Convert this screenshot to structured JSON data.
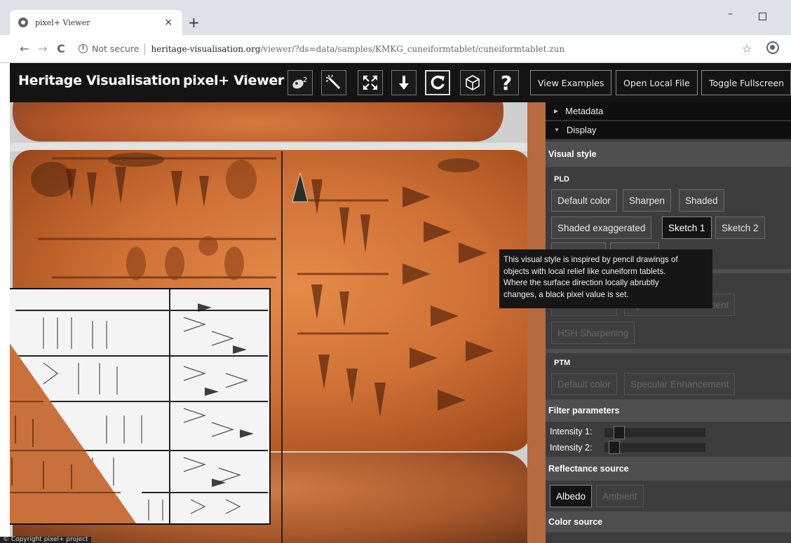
{
  "browser": {
    "tab_title": "pixel+ Viewer",
    "tab_close": "×",
    "new_tab": "+",
    "minimize": "–",
    "not_secure": "Not secure",
    "url_host": "heritage-visualisation.org",
    "url_path": "/viewer/?ds=data/samples/KMKG_cuneiformtablet/cuneiformtablet.zun",
    "back": "←",
    "forward": "→",
    "reload": "C",
    "info": "i",
    "star": "☆"
  },
  "header": {
    "brand": "Heritage Visualisation",
    "title": "pixel+ Viewer",
    "tools": [
      {
        "icon": "light-source-icon",
        "glyph": "☄"
      },
      {
        "icon": "magic-wand-icon",
        "glyph": "✨"
      },
      {
        "icon": "fullscreen-arrows-icon",
        "glyph": "⤧"
      },
      {
        "icon": "download-arrow-icon",
        "glyph": "⬇"
      },
      {
        "icon": "refresh-icon",
        "glyph": "↻"
      },
      {
        "icon": "cube-icon",
        "glyph": "⬡"
      },
      {
        "icon": "help-icon",
        "glyph": "?"
      }
    ],
    "buttons": [
      "View Examples",
      "Open Local File",
      "Toggle Fullscreen"
    ]
  },
  "panel": {
    "metadata": "Metadata",
    "display": "Display",
    "visual_style": "Visual style",
    "pld_label": "PLD",
    "pld_buttons": [
      "Default color",
      "Sharpen",
      "Shaded",
      "Shaded exaggerated",
      "Sketch 1",
      "Sketch 2"
    ],
    "hsh_buttons": [
      "Default color",
      "Specular Enhancement",
      "HSH Sharpening"
    ],
    "ptm_label": "PTM",
    "ptm_buttons": [
      "Default color",
      "Specular Enhancement"
    ],
    "filter_parameters": "Filter parameters",
    "intensity1_label": "Intensity 1:",
    "intensity2_label": "Intensity 2:",
    "intensity1": 0.1,
    "intensity2": 0.05,
    "reflectance_source": "Reflectance source",
    "reflectance_buttons": [
      "Albedo",
      "Ambient"
    ],
    "color_source": "Color source"
  },
  "tooltip": {
    "lines": [
      "This visual style is inspired by pencil drawings of",
      "objects with local relief like cuneiform tablets.",
      "Where the surface direction locally abrubtly",
      "changes, a black pixel value is set."
    ]
  },
  "copyright": "© Copyright pixel+ project",
  "colors": {
    "header_bg": "#141414",
    "panel_bg": "#3d3d3d",
    "tablet_orange": "#cf7136"
  }
}
